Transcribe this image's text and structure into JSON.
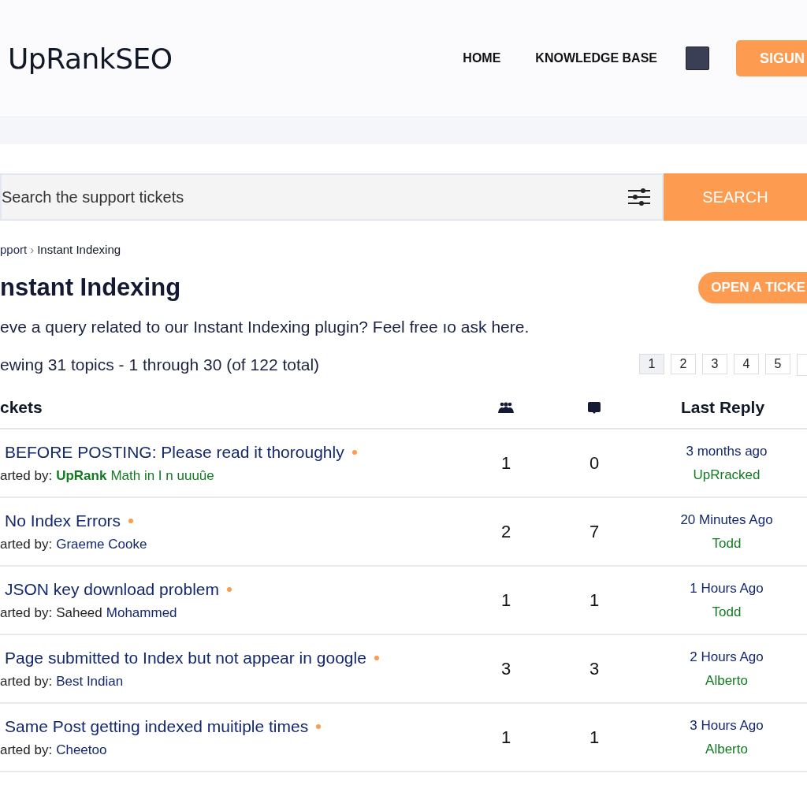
{
  "header": {
    "logo": "UpRankSEO",
    "nav": [
      "HOME",
      "KNOWLEDGE BASE"
    ],
    "signup": "SIGUN"
  },
  "search": {
    "placeholder": "Search the support tickets",
    "button": "SEARCH"
  },
  "breadcrumb": {
    "parent": "pport",
    "separator": "›",
    "current": "Instant Indexing"
  },
  "title": "nstant Indexing",
  "open_ticket": "OPEN A TICKE",
  "description": "eve a query related to our Instant Indexing plugin? Feel free  ıo ask here.",
  "summary": "ewing 31 topics - 1 through 30 (of 122 total)",
  "pages": [
    {
      "label": "1",
      "selected": true
    },
    {
      "label": "2",
      "selected": false
    },
    {
      "label": "3",
      "selected": false
    },
    {
      "label": "4",
      "selected": false
    },
    {
      "label": "5",
      "selected": false
    }
  ],
  "table": {
    "columns": [
      "ckets",
      "Last Reply"
    ],
    "rows": [
      {
        "title": "BEFORE POSTING: Please read it thoroughly",
        "started_label": "arted by:",
        "starter": [
          {
            "text": "UpRank",
            "kind": "strong"
          },
          {
            "text": "Math in I n uuuûe",
            "kind": "green"
          }
        ],
        "voices": "1",
        "posts": "0",
        "reply_time": "3 months ago",
        "reply_by": "UpRracked"
      },
      {
        "title": "No Index Errors",
        "started_label": "arted by:",
        "starter": [
          {
            "text": "Graeme Cooke",
            "kind": "link"
          }
        ],
        "voices": "2",
        "posts": "7",
        "reply_time": "20 Minutes Ago",
        "reply_by": "Todd"
      },
      {
        "title": "JSON key download problem",
        "started_label": "arted by:",
        "starter": [
          {
            "text": "Saheed",
            "kind": "plain"
          },
          {
            "text": "Mohammed",
            "kind": "link"
          }
        ],
        "voices": "1",
        "posts": "1",
        "reply_time": "1 Hours Ago",
        "reply_by": "Todd"
      },
      {
        "title": "Page submitted to Index but not appear in google",
        "started_label": "arted by:",
        "starter": [
          {
            "text": "Best Indian",
            "kind": "link"
          }
        ],
        "voices": "3",
        "posts": "3",
        "reply_time": "2 Hours Ago",
        "reply_by": "Alberto"
      },
      {
        "title": "Same Post getting indexed muitiple times",
        "started_label": "arted by:",
        "starter": [
          {
            "text": "Cheetoo",
            "kind": "link"
          }
        ],
        "voices": "1",
        "posts": "1",
        "reply_time": "3 Hours Ago",
        "reply_by": "Alberto"
      }
    ]
  }
}
